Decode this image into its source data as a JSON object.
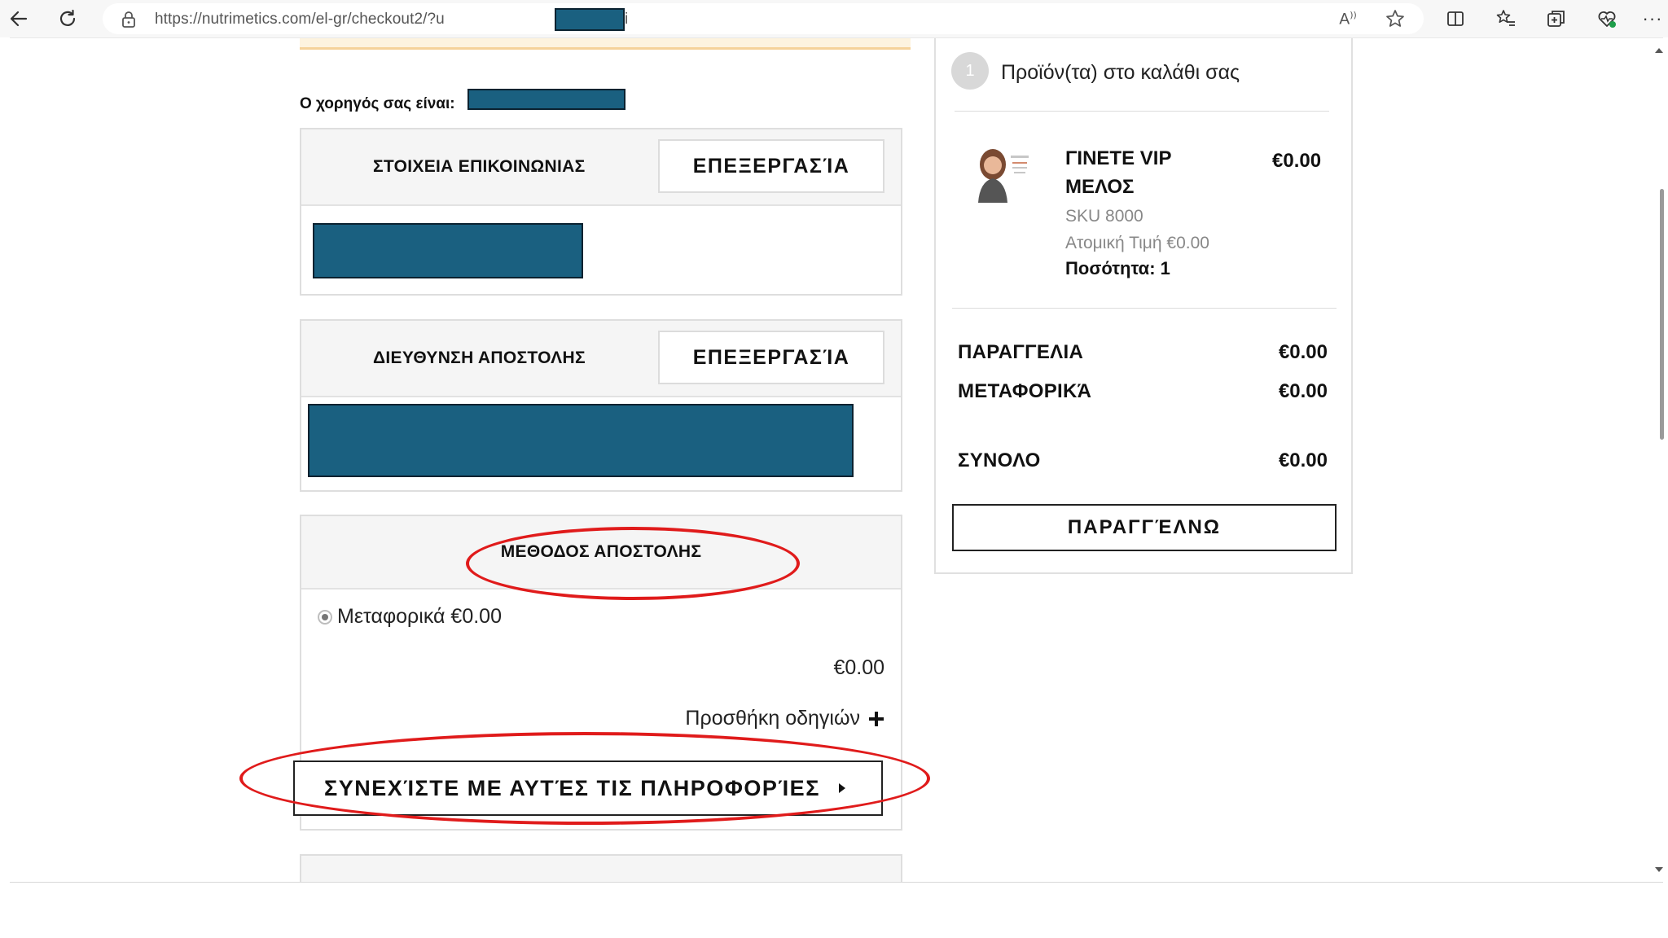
{
  "browser": {
    "url": "https://nutrimetics.com/el-gr/checkout2/?u",
    "url_tail": "i",
    "back_icon": "arrow-left-icon",
    "refresh_icon": "refresh-icon",
    "lock_icon": "lock-icon",
    "toolbar_icons": [
      "read-aloud-icon",
      "favorite-star-icon",
      "split-screen-icon",
      "favorites-list-icon",
      "collections-icon",
      "browser-essentials-icon",
      "more-icon"
    ],
    "read_aloud_label": "Â"
  },
  "checkout": {
    "sponsor_label": "Ο χορηγός σας είναι:",
    "contact": {
      "title": "ΣΤΟΙΧΕΙΑ ΕΠΙΚΟΙΝΩΝΙΑΣ",
      "edit_label": "ΕΠΕΞΕΡΓΑΣΊΑ"
    },
    "shipping_address": {
      "title": "ΔΙΕΥΘΥΝΣΗ ΑΠΟΣΤΟΛΗΣ",
      "edit_label": "ΕΠΕΞΕΡΓΑΣΊΑ"
    },
    "shipping_method": {
      "title": "ΜΕΘΟΔΟΣ ΑΠΟΣΤΟΛΗΣ",
      "option_label": "Μεταφορικά €0.00",
      "amount": "€0.00",
      "add_instructions_label": "Προσθήκη οδηγιών",
      "add_icon": "plus-icon",
      "continue_label": "ΣΥΝΕΧΊΣΤΕ ΜΕ ΑΥΤΈΣ ΤΙΣ ΠΛΗΡΟΦΟΡΊΕΣ",
      "continue_icon": "caret-right-icon"
    }
  },
  "summary": {
    "step_number": "1",
    "title": "Προϊόν(τα) στο καλάθι σας",
    "item": {
      "name_line1": "ΓΙΝΕΤΕ VIP",
      "name_line2": "ΜΕΛΟΣ",
      "price": "€0.00",
      "sku": "SKU 8000",
      "unit_price": "Ατομική Τιμή €0.00",
      "quantity": "Ποσότητα: 1"
    },
    "order_label": "ΠΑΡΑΓΓΕΛΙΑ",
    "order_value": "€0.00",
    "shipping_label": "ΜΕΤΑΦΟΡΙΚΆ",
    "shipping_value": "€0.00",
    "total_label": "ΣΥΝΟΛΟ",
    "total_value": "€0.00",
    "place_order_label": "ΠΑΡΑΓΓΈΛΝΩ"
  },
  "colors": {
    "redaction": "#1a6080",
    "annotation": "#e01b1b",
    "alert_border": "#f5d29a"
  }
}
